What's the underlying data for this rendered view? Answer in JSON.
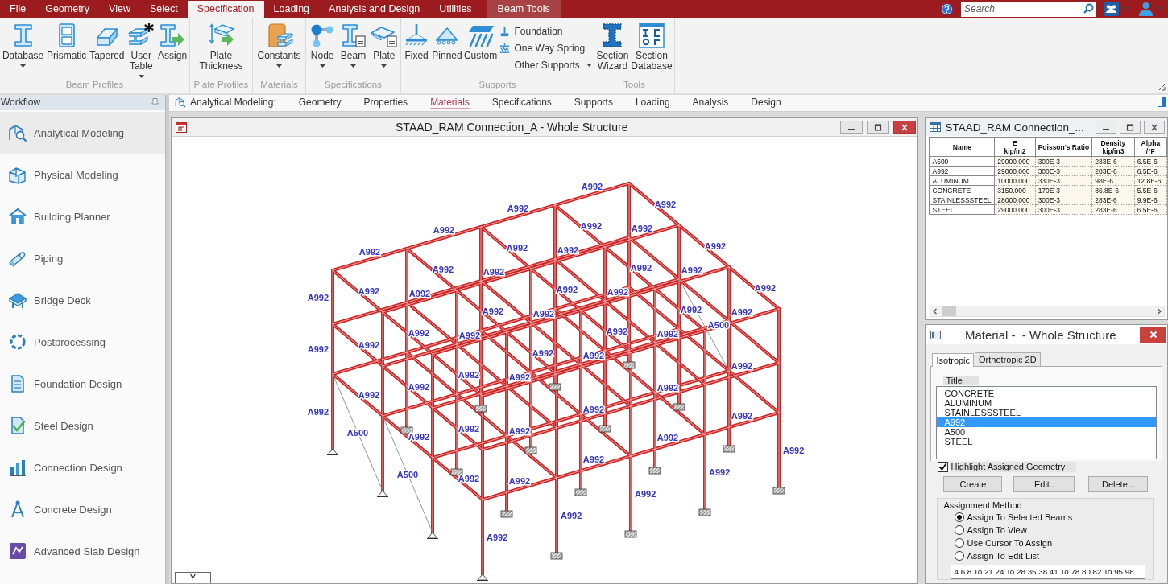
{
  "menu_tabs": [
    {
      "label": "File",
      "selected": false,
      "kind": "normal"
    },
    {
      "label": "Geometry",
      "selected": false,
      "kind": "normal"
    },
    {
      "label": "View",
      "selected": false,
      "kind": "normal"
    },
    {
      "label": "Select",
      "selected": false,
      "kind": "normal"
    },
    {
      "label": "Specification",
      "selected": true,
      "kind": "normal"
    },
    {
      "label": "Loading",
      "selected": false,
      "kind": "normal"
    },
    {
      "label": "Analysis and Design",
      "selected": false,
      "kind": "normal"
    },
    {
      "label": "Utilities",
      "selected": false,
      "kind": "normal"
    },
    {
      "label": "Beam Tools",
      "selected": false,
      "kind": "contextual"
    }
  ],
  "search": {
    "placeholder": "Search"
  },
  "ribbon_groups": [
    {
      "title": "Beam Profiles",
      "buttons": [
        {
          "label": "Database",
          "dropdown": true
        },
        {
          "label": "Prismatic",
          "dropdown": false
        },
        {
          "label": "Tapered",
          "dropdown": false
        },
        {
          "label": "User Table",
          "dropdown": true
        },
        {
          "label": "Assign",
          "dropdown": false
        }
      ]
    },
    {
      "title": "Plate Profiles",
      "buttons": [
        {
          "label": "Plate Thickness",
          "dropdown": false
        }
      ]
    },
    {
      "title": "Materials",
      "buttons": [
        {
          "label": "Constants",
          "dropdown": true
        }
      ]
    },
    {
      "title": "Specifications",
      "buttons": [
        {
          "label": "Node",
          "dropdown": true
        },
        {
          "label": "Beam",
          "dropdown": true
        },
        {
          "label": "Plate",
          "dropdown": true
        }
      ]
    },
    {
      "title": "Supports",
      "buttons": [
        {
          "label": "Fixed",
          "dropdown": false
        },
        {
          "label": "Pinned",
          "dropdown": false
        },
        {
          "label": "Custom",
          "dropdown": false
        }
      ],
      "small_buttons": [
        {
          "label": "Foundation",
          "dropdown": false
        },
        {
          "label": "One Way Spring",
          "dropdown": false
        },
        {
          "label": "Other Supports",
          "dropdown": true
        }
      ]
    },
    {
      "title": "Tools",
      "buttons": [
        {
          "label": "Section Wizard",
          "dropdown": false
        },
        {
          "label": "Section Database",
          "dropdown": false
        }
      ]
    }
  ],
  "workflow": {
    "title": "Workflow",
    "items": [
      {
        "label": "Analytical Modeling",
        "selected": true
      },
      {
        "label": "Physical Modeling",
        "selected": false
      },
      {
        "label": "Building Planner",
        "selected": false
      },
      {
        "label": "Piping",
        "selected": false
      },
      {
        "label": "Bridge Deck",
        "selected": false
      },
      {
        "label": "Postprocessing",
        "selected": false
      },
      {
        "label": "Foundation Design",
        "selected": false
      },
      {
        "label": "Steel Design",
        "selected": false
      },
      {
        "label": "Connection Design",
        "selected": false
      },
      {
        "label": "Concrete Design",
        "selected": false
      },
      {
        "label": "Advanced Slab Design",
        "selected": false
      }
    ]
  },
  "workflow_bar": {
    "title": "Analytical Modeling:",
    "tabs": [
      {
        "label": "Geometry",
        "selected": false
      },
      {
        "label": "Properties",
        "selected": false
      },
      {
        "label": "Materials",
        "selected": true
      },
      {
        "label": "Specifications",
        "selected": false
      },
      {
        "label": "Supports",
        "selected": false
      },
      {
        "label": "Loading",
        "selected": false
      },
      {
        "label": "Analysis",
        "selected": false
      },
      {
        "label": "Design",
        "selected": false
      }
    ]
  },
  "structure_window": {
    "title": "STAAD_RAM Connection_A - Whole Structure",
    "member_labels": [
      "A992",
      "A992",
      "A992",
      "A992",
      "A992",
      "A992",
      "A992",
      "A992",
      "A992",
      "A992",
      "A992",
      "A992",
      "A992",
      "A992",
      "A992",
      "A992",
      "A992",
      "A992",
      "A992",
      "A992",
      "A992",
      "A992",
      "A992",
      "A992",
      "A992",
      "A992",
      "A992",
      "A992",
      "A992",
      "A992",
      "A992",
      "A992",
      "A992",
      "A992",
      "A992",
      "A992",
      "A992",
      "A992",
      "A992",
      "A992",
      "A992",
      "A992",
      "A992",
      "A992",
      "A992",
      "A992",
      "A992",
      "A992",
      "A992",
      "A992",
      "A992",
      "A992",
      "A992",
      "A500",
      "A500",
      "A500"
    ],
    "view_tab": "Y"
  },
  "table_window": {
    "title": "STAAD_RAM Connection_...",
    "columns": [
      {
        "name": "Name"
      },
      {
        "name": "E",
        "unit": "kip/in2"
      },
      {
        "name": "Poisson's Ratio"
      },
      {
        "name": "Density",
        "unit": "kip/in3"
      },
      {
        "name": "Alpha",
        "unit": "/°F"
      }
    ],
    "rows": [
      [
        "A500",
        "29000.000",
        "300E-3",
        "283E-6",
        "6.5E-6"
      ],
      [
        "A992",
        "29000.000",
        "300E-3",
        "283E-6",
        "6.5E-6"
      ],
      [
        "ALUMINUM",
        "10000.000",
        "330E-3",
        "98E-6",
        "12.8E-6"
      ],
      [
        "CONCRETE",
        "3150.000",
        "170E-3",
        "86.8E-6",
        "5.5E-6"
      ],
      [
        "STAINLESSSTEEL",
        "28000.000",
        "300E-3",
        "283E-6",
        "9.9E-6"
      ],
      [
        "STEEL",
        "29000.000",
        "300E-3",
        "283E-6",
        "6.5E-6"
      ]
    ]
  },
  "material_dialog": {
    "title": "Material -  - Whole Structure",
    "tabs": [
      {
        "label": "Isotropic",
        "selected": true
      },
      {
        "label": "Orthotropic 2D",
        "selected": false
      }
    ],
    "list_header": "Title",
    "materials": [
      {
        "label": "CONCRETE",
        "selected": false
      },
      {
        "label": "ALUMINUM",
        "selected": false
      },
      {
        "label": "STAINLESSSTEEL",
        "selected": false
      },
      {
        "label": "A992",
        "selected": true
      },
      {
        "label": "A500",
        "selected": false
      },
      {
        "label": "STEEL",
        "selected": false
      }
    ],
    "highlight": {
      "label": "Highlight Assigned Geometry",
      "checked": true
    },
    "buttons": [
      "Create",
      "Edit..",
      "Delete..."
    ],
    "assignment": {
      "title": "Assignment Method",
      "options": [
        {
          "label": "Assign To Selected Beams",
          "selected": true
        },
        {
          "label": "Assign To View",
          "selected": false
        },
        {
          "label": "Use Cursor To Assign",
          "selected": false
        },
        {
          "label": "Assign To Edit List",
          "selected": false
        }
      ],
      "edit_list": "4 6 8 To 21 24 To 28 35 38 41 To 78 80 82 To 95 98"
    }
  }
}
